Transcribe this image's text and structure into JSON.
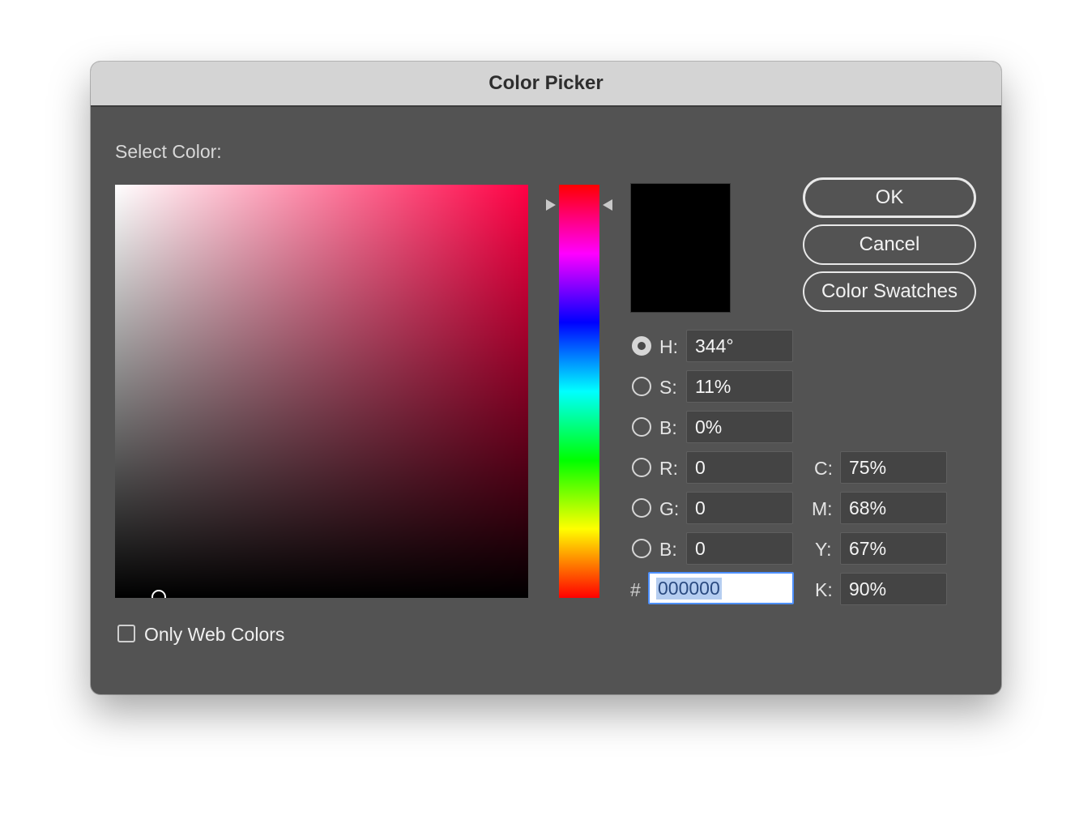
{
  "window": {
    "title": "Color Picker"
  },
  "select_color_label": "Select Color:",
  "current_color": "#000000",
  "buttons": {
    "ok": "OK",
    "cancel": "Cancel",
    "swatches": "Color Swatches"
  },
  "hsb": {
    "h": {
      "label": "H:",
      "value": "344°",
      "selected": true
    },
    "s": {
      "label": "S:",
      "value": "11%",
      "selected": false
    },
    "b": {
      "label": "B:",
      "value": "0%",
      "selected": false
    }
  },
  "rgb": {
    "r": {
      "label": "R:",
      "value": "0",
      "selected": false
    },
    "g": {
      "label": "G:",
      "value": "0",
      "selected": false
    },
    "b": {
      "label": "B:",
      "value": "0",
      "selected": false
    }
  },
  "cmyk": {
    "c": {
      "label": "C:",
      "value": "75%"
    },
    "m": {
      "label": "M:",
      "value": "68%"
    },
    "y": {
      "label": "Y:",
      "value": "67%"
    },
    "k": {
      "label": "K:",
      "value": "90%"
    }
  },
  "hex": {
    "label": "#",
    "value": "000000"
  },
  "only_web_colors": {
    "label": "Only Web Colors",
    "checked": false
  },
  "colors": {
    "hue_base": "#ff0044",
    "focus_ring": "#4d90fe"
  }
}
